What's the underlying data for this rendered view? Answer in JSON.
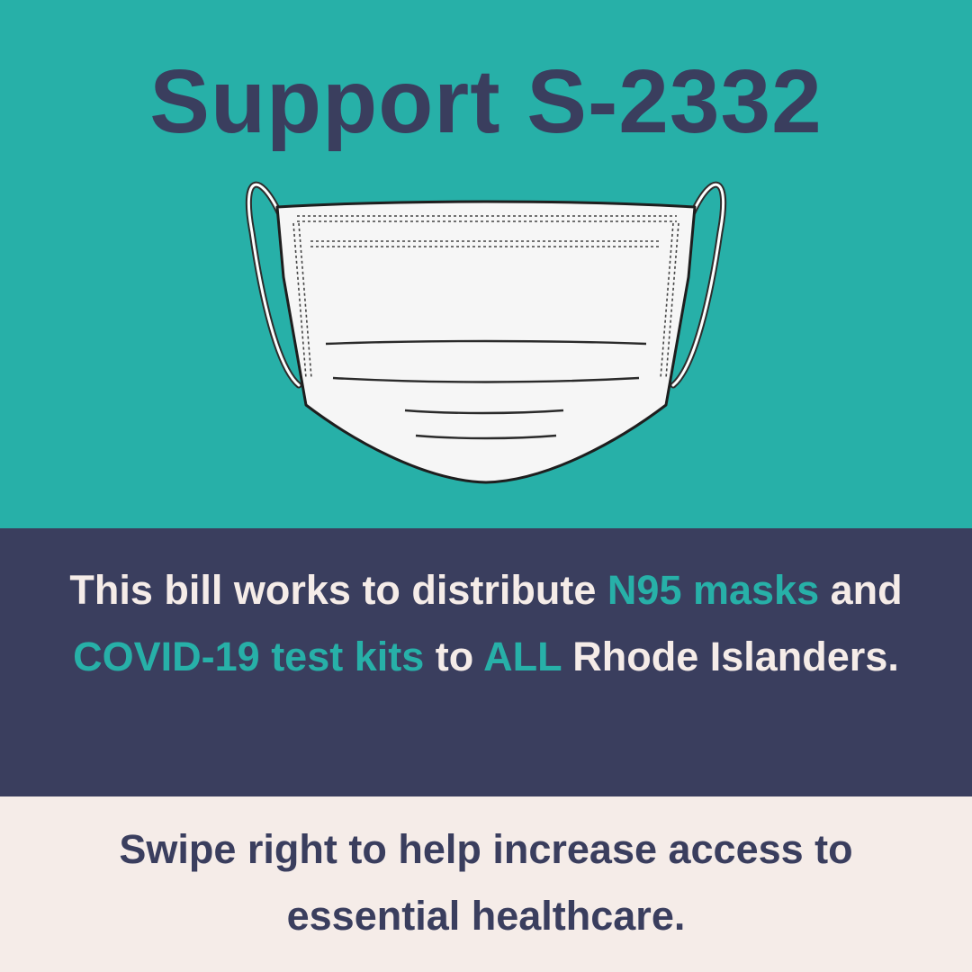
{
  "headline": "Support S-2332",
  "bill_text": {
    "part1": "This bill works to distribute ",
    "hl1": "N95 masks",
    "part2": " and ",
    "hl2": "COVID-19 test kits",
    "part3": " to ",
    "hl3": "ALL",
    "part4": " Rhode Islanders."
  },
  "cta": "Swipe right to help increase access to essential healthcare.",
  "colors": {
    "teal": "#27b0a8",
    "navy": "#3a3e5e",
    "cream": "#f5ece8"
  },
  "illustration": "surgical-mask-icon"
}
